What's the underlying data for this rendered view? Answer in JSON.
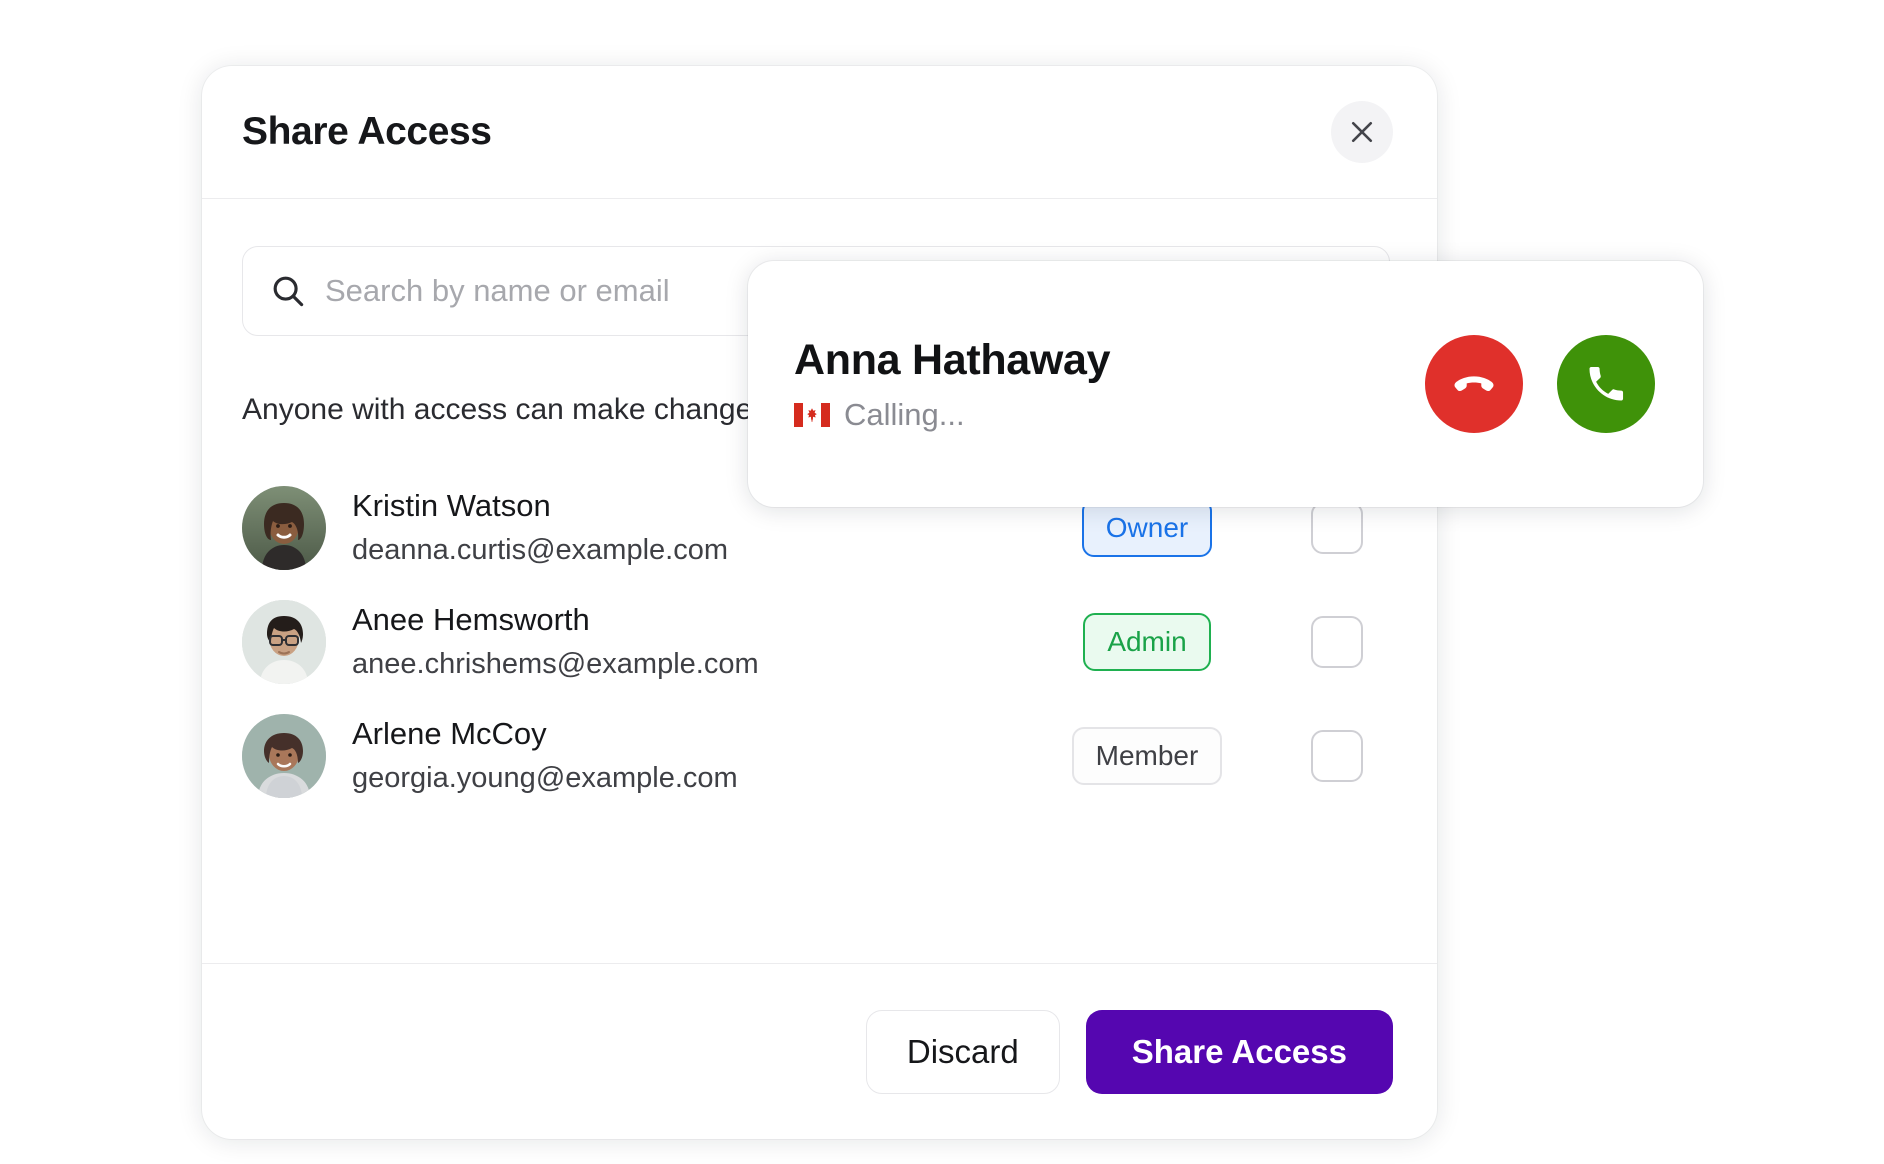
{
  "modal": {
    "title": "Share Access",
    "close_icon": "close-icon",
    "search": {
      "icon": "search-icon",
      "placeholder": "Search by name or email",
      "value": ""
    },
    "help_text": "Anyone with access can make changes",
    "members": [
      {
        "name": "Kristin Watson",
        "email": "deanna.curtis@example.com",
        "role": "Owner",
        "role_style": "owner",
        "checked": false
      },
      {
        "name": "Anee Hemsworth",
        "email": "anee.chrishems@example.com",
        "role": "Admin",
        "role_style": "admin",
        "checked": false
      },
      {
        "name": "Arlene McCoy",
        "email": "georgia.young@example.com",
        "role": "Member",
        "role_style": "member",
        "checked": false
      }
    ],
    "footer": {
      "discard_label": "Discard",
      "share_label": "Share Access"
    }
  },
  "call_card": {
    "caller_name": "Anna Hathaway",
    "country_flag": "canada-flag-icon",
    "status": "Calling...",
    "decline_icon": "phone-hangup-icon",
    "accept_icon": "phone-icon"
  },
  "colors": {
    "primary_purple": "#5506B0",
    "owner_blue": "#1A73E8",
    "admin_green": "#1FB050",
    "decline_red": "#E0302B",
    "accept_green": "#3F9209",
    "muted_text": "#8A8B92"
  }
}
